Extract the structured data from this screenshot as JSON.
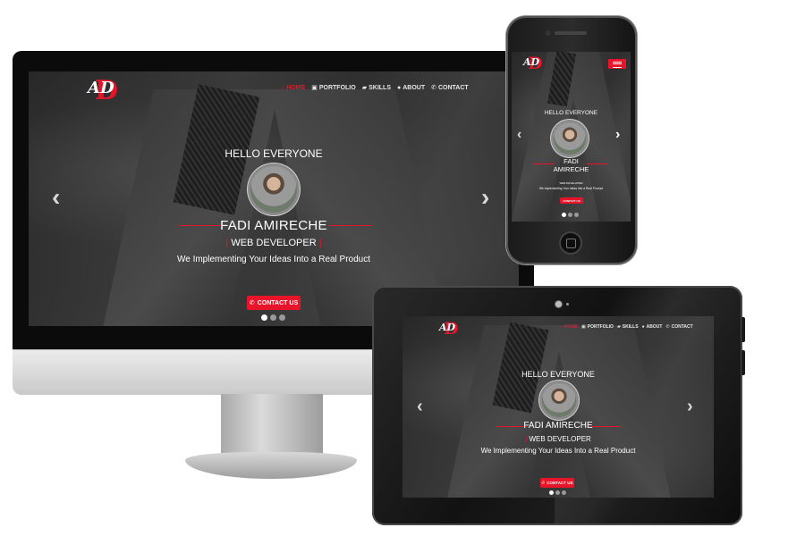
{
  "brand": {
    "logo_letters": "AD",
    "accent_color": "#e8152a"
  },
  "nav": {
    "items": [
      {
        "label": "HOME",
        "icon": "home-icon",
        "active": true
      },
      {
        "label": "PORTFOLIO",
        "icon": "briefcase-icon",
        "active": false
      },
      {
        "label": "SKILLS",
        "icon": "graduation-cap-icon",
        "active": false
      },
      {
        "label": "ABOUT",
        "icon": "info-icon",
        "active": false
      },
      {
        "label": "CONTACT",
        "icon": "phone-icon",
        "active": false
      }
    ]
  },
  "hero": {
    "greeting": "HELLO EVERYONE",
    "name": "FADI AMIRECHE",
    "name_line1": "FADI",
    "name_line2": "AMIRECHE",
    "role": "WEB DEVELOPER",
    "role_bar": "|",
    "tagline": "We Implementing Your Ideas Into a Real Product",
    "contact_button": "CONTACT US",
    "prev_arrow": "‹",
    "next_arrow": "›",
    "slides_total": 3,
    "active_slide": 1
  }
}
